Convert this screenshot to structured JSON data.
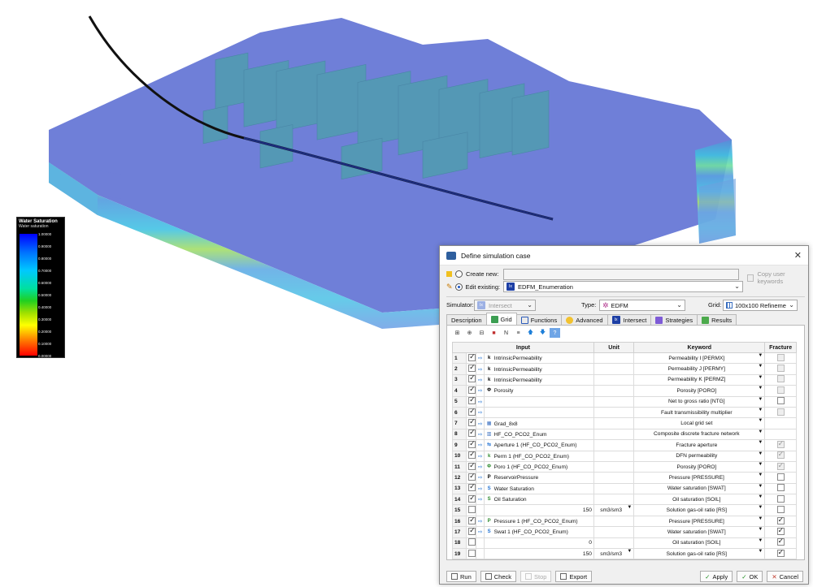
{
  "legend": {
    "title": "Water Saturation",
    "subtitle": "Water saturation",
    "ticks": [
      "1.00000",
      "0.90000",
      "0.80000",
      "0.70000",
      "0.60000",
      "0.50000",
      "0.40000",
      "0.30000",
      "0.20000",
      "0.10000",
      "0.00000"
    ]
  },
  "dialog": {
    "title": "Define simulation case",
    "create_new_label": "Create new:",
    "copy_user_keywords_label": "Copy user keywords",
    "edit_existing_label": "Edit existing:",
    "edit_existing_value": "EDFM_Enumeration",
    "simulator_label": "Simulator:",
    "simulator_value": "Intersect",
    "type_label": "Type:",
    "type_value": "EDFM",
    "grid_label": "Grid:",
    "grid_value": "100x100 Refineme",
    "tabs": [
      "Description",
      "Grid",
      "Functions",
      "Advanced",
      "Intersect",
      "Strategies",
      "Results"
    ],
    "columns": {
      "input": "Input",
      "unit": "Unit",
      "keyword": "Keyword",
      "fracture": "Fracture"
    },
    "rows": [
      {
        "n": "1",
        "input": "IntrinsicPermeability",
        "unit": "",
        "keyword": "Permeability I [PERMX]",
        "frac": "dis",
        "chk": true
      },
      {
        "n": "2",
        "input": "IntrinsicPermeability",
        "unit": "",
        "keyword": "Permeability J [PERMY]",
        "frac": "dis",
        "chk": true
      },
      {
        "n": "3",
        "input": "IntrinsicPermeability",
        "unit": "",
        "keyword": "Permeability K [PERMZ]",
        "frac": "dis",
        "chk": true
      },
      {
        "n": "4",
        "input": "Porosity",
        "unit": "",
        "keyword": "Porosity [PORO]",
        "frac": "dis",
        "chk": true
      },
      {
        "n": "5",
        "input": "",
        "unit": "",
        "keyword": "Net to gross ratio [NTG]",
        "frac": "off",
        "chk": true
      },
      {
        "n": "6",
        "input": "",
        "unit": "",
        "keyword": "Fault transmissibility multiplier",
        "frac": "dis",
        "chk": true
      },
      {
        "n": "7",
        "input": "Grad_8x8",
        "unit": "",
        "keyword": "Local grid set",
        "frac": "none",
        "chk": true
      },
      {
        "n": "8",
        "input": "HF_CO_PCO2_Enum",
        "unit": "",
        "keyword": "Composite discrete fracture network",
        "frac": "none",
        "chk": true
      },
      {
        "n": "9",
        "input": "Aperture 1 (HF_CO_PCO2_Enum)",
        "unit": "",
        "keyword": "Fracture aperture",
        "frac": "dison",
        "chk": true
      },
      {
        "n": "10",
        "input": "Perm 1 (HF_CO_PCO2_Enum)",
        "unit": "",
        "keyword": "DFN permeability",
        "frac": "dison",
        "chk": true
      },
      {
        "n": "11",
        "input": "Poro 1 (HF_CO_PCO2_Enum)",
        "unit": "",
        "keyword": "Porosity [PORO]",
        "frac": "dison",
        "chk": true
      },
      {
        "n": "12",
        "input": "ReservoirPressure",
        "unit": "",
        "keyword": "Pressure [PRESSURE]",
        "frac": "off",
        "chk": true
      },
      {
        "n": "13",
        "input": "Water Saturation",
        "unit": "",
        "keyword": "Water saturation [SWAT]",
        "frac": "off",
        "chk": true
      },
      {
        "n": "14",
        "input": "Oil Saturation",
        "unit": "",
        "keyword": "Oil saturation [SOIL]",
        "frac": "off",
        "chk": true
      },
      {
        "n": "15",
        "input": "150",
        "unit": "sm3/sm3",
        "keyword": "Solution gas-oil ratio [RS]",
        "frac": "off",
        "chk": false
      },
      {
        "n": "16",
        "input": "Pressure 1 (HF_CO_PCO2_Enum)",
        "unit": "",
        "keyword": "Pressure [PRESSURE]",
        "frac": "on",
        "chk": true
      },
      {
        "n": "17",
        "input": "Swat 1 (HF_CO_PCO2_Enum)",
        "unit": "",
        "keyword": "Water saturation [SWAT]",
        "frac": "on",
        "chk": true
      },
      {
        "n": "18",
        "input": "0",
        "unit": "",
        "keyword": "Oil saturation [SOIL]",
        "frac": "on",
        "chk": false
      },
      {
        "n": "19",
        "input": "150",
        "unit": "sm3/sm3",
        "keyword": "Solution gas-oil ratio [RS]",
        "frac": "on",
        "chk": false
      }
    ],
    "buttons": {
      "run": "Run",
      "check": "Check",
      "stop": "Stop",
      "export": "Export",
      "apply": "Apply",
      "ok": "OK",
      "cancel": "Cancel"
    }
  }
}
